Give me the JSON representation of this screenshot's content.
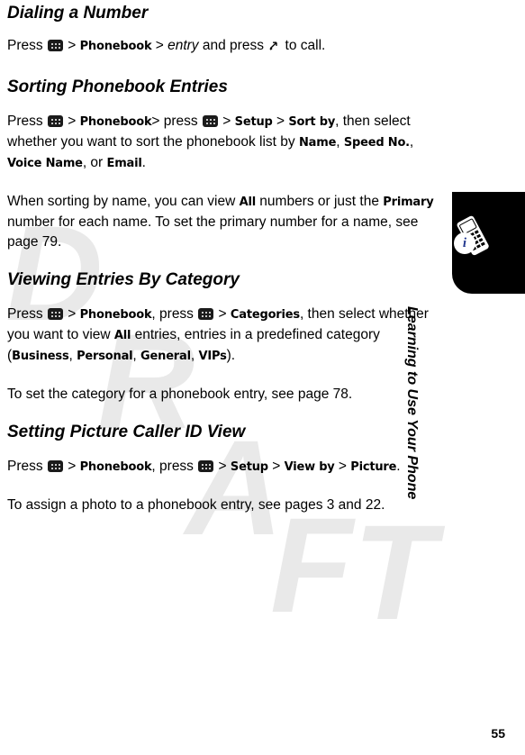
{
  "page": {
    "number": "55",
    "side_title": "Learning to Use Your Phone",
    "watermark": [
      "D",
      "R",
      "A",
      "F",
      "T"
    ],
    "info_icon_letter": "i"
  },
  "sections": [
    {
      "heading": "Dialing a Number",
      "paragraphs": [
        "Press M > Phonebook > entry and press N to call."
      ]
    },
    {
      "heading": "Sorting Phonebook Entries",
      "paragraphs": [
        "Press M  > Phonebook> press M  > Setup > Sort by, then select whether you want to sort the phonebook list by Name, Speed No., Voice Name, or Email.",
        "When sorting by name, you can view All numbers or just the Primary number for each name. To set the primary number for a name, see page 79."
      ]
    },
    {
      "heading": "Viewing Entries By Category",
      "paragraphs": [
        "Press M > Phonebook, press M > Categories, then select whether you want to view All entries, entries in a predefined category (Business, Personal, General, VIPs).",
        "To set the category for a phonebook entry, see page 78."
      ]
    },
    {
      "heading": "Setting Picture Caller ID View",
      "paragraphs": [
        "Press M > Phonebook, press M > Setup > View by > Picture.",
        "To assign a photo to a phonebook entry, see pages 3 and 22."
      ]
    }
  ],
  "text": {
    "s1_p1_a": "Press ",
    "s1_p1_b": " > ",
    "s1_p1_phonebook": "Phonebook",
    "s1_p1_c": " > ",
    "s1_p1_entry": "entry",
    "s1_p1_d": " and press ",
    "s1_p1_e": " to call.",
    "s2_p1_a": "Press ",
    "s2_p1_b": "  > ",
    "s2_p1_phonebook": "Phonebook",
    "s2_p1_c": "> press ",
    "s2_p1_d": "  > ",
    "s2_p1_setup": "Setup",
    "s2_p1_e": " > ",
    "s2_p1_sortby": "Sort by",
    "s2_p1_f": ", then select whether you want to sort the phonebook list by ",
    "s2_p1_name": "Name",
    "s2_p1_g": ", ",
    "s2_p1_speedno": "Speed No.",
    "s2_p1_h": ", ",
    "s2_p1_voicename": "Voice Name",
    "s2_p1_i": ", or ",
    "s2_p1_email": "Email",
    "s2_p1_j": ".",
    "s2_p2_a": "When sorting by name, you can view ",
    "s2_p2_all": "All",
    "s2_p2_b": " numbers or just the ",
    "s2_p2_primary": "Primary",
    "s2_p2_c": " number for each name. To set the primary number for a name, see page 79.",
    "s3_p1_a": "Press ",
    "s3_p1_b": " > ",
    "s3_p1_phonebook": "Phonebook",
    "s3_p1_c": ", press ",
    "s3_p1_d": " > ",
    "s3_p1_categories": "Categories",
    "s3_p1_e": ", then select whether you want to view ",
    "s3_p1_all": "All",
    "s3_p1_f": " entries, entries in a predefined category (",
    "s3_p1_business": "Business",
    "s3_p1_g": ", ",
    "s3_p1_personal": "Personal",
    "s3_p1_h": ", ",
    "s3_p1_general": "General",
    "s3_p1_i": ", ",
    "s3_p1_vips": "VIPs",
    "s3_p1_j": ").",
    "s3_p2": "To set the category for a phonebook entry, see page 78.",
    "s4_p1_a": "Press ",
    "s4_p1_b": " > ",
    "s4_p1_phonebook": "Phonebook",
    "s4_p1_c": ", press ",
    "s4_p1_d": " > ",
    "s4_p1_setup": "Setup",
    "s4_p1_e": " > ",
    "s4_p1_viewby": "View by",
    "s4_p1_f": " > ",
    "s4_p1_picture": "Picture",
    "s4_p1_g": ".",
    "s4_p2": "To assign a photo to a phonebook entry, see pages 3 and 22."
  },
  "colors": {
    "watermark": "#e9e9e9",
    "tab": "#000000",
    "info_letter": "#23398f",
    "text": "#000000"
  }
}
